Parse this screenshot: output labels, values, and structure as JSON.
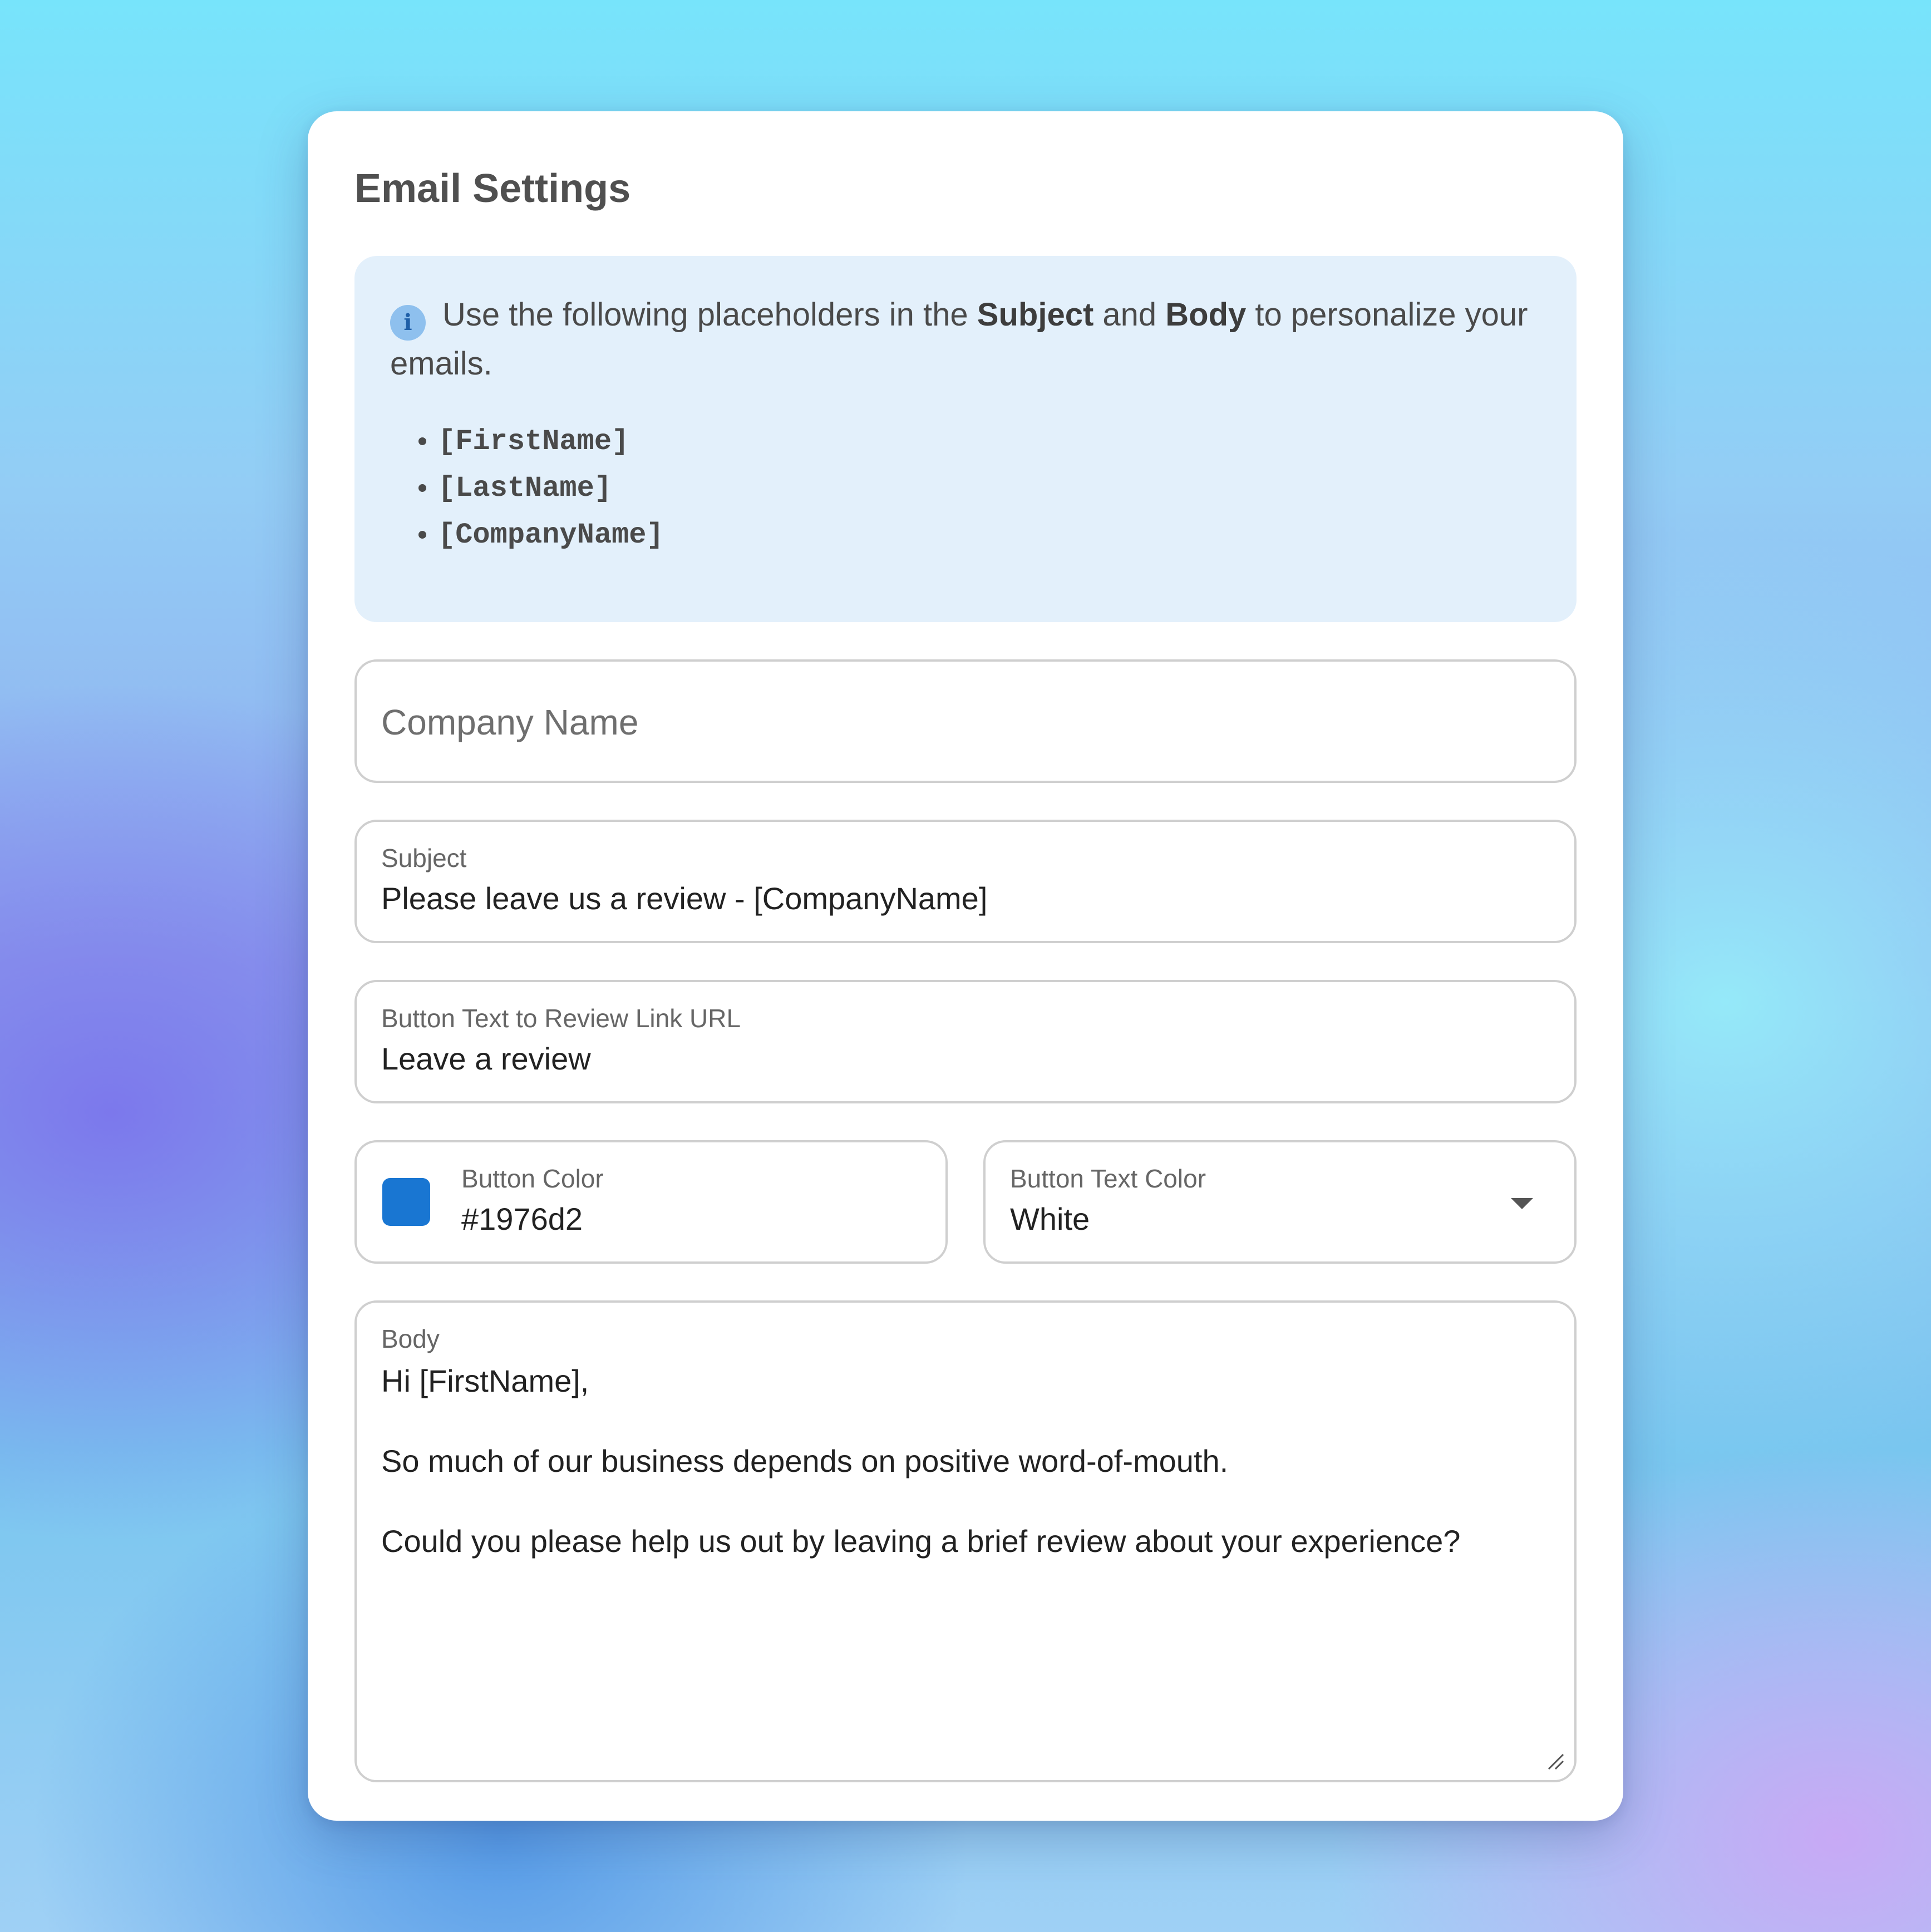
{
  "title": "Email Settings",
  "info": {
    "icon": "info-icon",
    "text_before": "Use the following placeholders in the ",
    "strong1": "Subject",
    "text_middle": " and ",
    "strong2": "Body",
    "text_after": " to personalize your emails.",
    "placeholders": [
      "[FirstName]",
      "[LastName]",
      "[CompanyName]"
    ]
  },
  "company_name": {
    "placeholder": "Company Name"
  },
  "subject": {
    "label": "Subject",
    "value": "Please leave us a review - [CompanyName]"
  },
  "button_text": {
    "label": "Button Text to Review Link URL",
    "value": "Leave a review"
  },
  "button_color": {
    "label": "Button Color",
    "value": "#1976d2",
    "swatch": "#1976d2"
  },
  "button_text_color": {
    "label": "Button Text Color",
    "value": "White",
    "icon": "chevron-down-icon"
  },
  "body": {
    "label": "Body",
    "value": "Hi [FirstName],\n\nSo much of our business depends on positive word-of-mouth.\n\nCould you please help us out by leaving a brief review about your experience?"
  }
}
